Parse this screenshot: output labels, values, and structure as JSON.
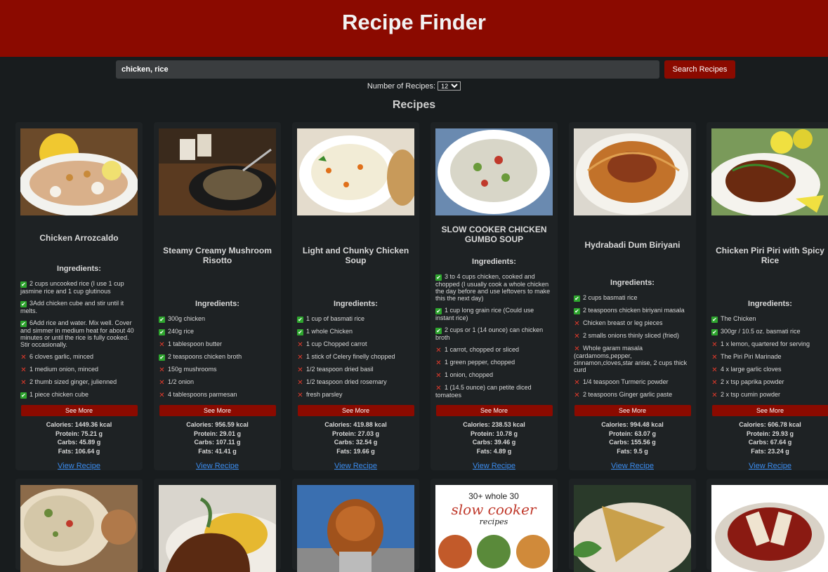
{
  "header": {
    "title": "Recipe Finder"
  },
  "search": {
    "value": "chicken, rice",
    "button_label": "Search Recipes"
  },
  "count": {
    "label": "Number of Recipes:",
    "value": "12"
  },
  "section_title": "Recipes",
  "labels": {
    "ingredients": "Ingredients:",
    "see_more": "See More",
    "view_recipe": "View Recipe"
  },
  "recipes": [
    {
      "title": "Chicken Arrozcaldo",
      "ingredients": [
        {
          "have": true,
          "text": "2 cups uncooked rice (I use 1 cup jasmine rice and 1 cup glutinous"
        },
        {
          "have": true,
          "text": "3Add chicken cube and stir until it melts."
        },
        {
          "have": true,
          "text": "6Add rice and water. Mix well. Cover and simmer in medium heat for about 40 minutes or until the rice is fully cooked. Stir occasionally."
        },
        {
          "have": false,
          "text": "6 cloves garlic, minced"
        },
        {
          "have": false,
          "text": "1 medium onion, minced"
        },
        {
          "have": false,
          "text": "2 thumb sized ginger, julienned"
        },
        {
          "have": true,
          "text": "1 piece chicken cube"
        }
      ],
      "nutrition": {
        "calories": "Calories: 1449.36 kcal",
        "protein": "Protein: 75.21 g",
        "carbs": "Carbs: 45.89 g",
        "fats": "Fats: 106.64 g"
      }
    },
    {
      "title": "Steamy Creamy Mushroom Risotto",
      "ingredients": [
        {
          "have": true,
          "text": "300g chicken"
        },
        {
          "have": true,
          "text": "240g rice"
        },
        {
          "have": false,
          "text": "1 tablespoon butter"
        },
        {
          "have": true,
          "text": "2 teaspoons chicken broth"
        },
        {
          "have": false,
          "text": "150g mushrooms"
        },
        {
          "have": false,
          "text": "1/2 onion"
        },
        {
          "have": false,
          "text": "4 tablespoons parmesan"
        }
      ],
      "nutrition": {
        "calories": "Calories: 956.59 kcal",
        "protein": "Protein: 29.01 g",
        "carbs": "Carbs: 107.11 g",
        "fats": "Fats: 41.41 g"
      }
    },
    {
      "title": "Light and Chunky Chicken Soup",
      "ingredients": [
        {
          "have": true,
          "text": "1 cup of basmati rice"
        },
        {
          "have": true,
          "text": "1 whole Chicken"
        },
        {
          "have": false,
          "text": "1 cup Chopped carrot"
        },
        {
          "have": false,
          "text": "1 stick of Celery finelly chopped"
        },
        {
          "have": false,
          "text": "1/2 teaspoon dried basil"
        },
        {
          "have": false,
          "text": "1/2 teaspoon dried rosemary"
        },
        {
          "have": false,
          "text": "fresh parsley"
        }
      ],
      "nutrition": {
        "calories": "Calories: 419.88 kcal",
        "protein": "Protein: 27.03 g",
        "carbs": "Carbs: 32.54 g",
        "fats": "Fats: 19.66 g"
      }
    },
    {
      "title": "SLOW COOKER CHICKEN GUMBO SOUP",
      "ingredients": [
        {
          "have": true,
          "text": "3 to 4 cups chicken, cooked and chopped (I usually cook a whole chicken the day before and use leftovers to make this the next day)"
        },
        {
          "have": true,
          "text": "1 cup long grain rice (Could use instant rice)"
        },
        {
          "have": true,
          "text": "2 cups or 1 (14 ounce) can chicken broth"
        },
        {
          "have": false,
          "text": "1 carrot, chopped or sliced"
        },
        {
          "have": false,
          "text": "1 green pepper, chopped"
        },
        {
          "have": false,
          "text": "1 onion, chopped"
        },
        {
          "have": false,
          "text": "1 (14.5 ounce) can petite diced tomatoes"
        }
      ],
      "nutrition": {
        "calories": "Calories: 238.53 kcal",
        "protein": "Protein: 10.78 g",
        "carbs": "Carbs: 39.46 g",
        "fats": "Fats: 4.89 g"
      }
    },
    {
      "title": "Hydrabadi Dum Biriyani",
      "ingredients": [
        {
          "have": true,
          "text": "2 cups basmati rice"
        },
        {
          "have": true,
          "text": "2 teaspoons chicken biriyani masala"
        },
        {
          "have": false,
          "text": "Chicken breast or leg pieces"
        },
        {
          "have": false,
          "text": "2 smalls onions thinly sliced (fried)"
        },
        {
          "have": false,
          "text": "Whole garam masala (cardamoms,pepper, cinnamon,cloves,star anise, 2 cups thick curd"
        },
        {
          "have": false,
          "text": "1/4 teaspoon Turmeric powder"
        },
        {
          "have": false,
          "text": "2 teaspoons Ginger garlic paste"
        }
      ],
      "nutrition": {
        "calories": "Calories: 994.48 kcal",
        "protein": "Protein: 63.07 g",
        "carbs": "Carbs: 155.56 g",
        "fats": "Fats: 9.5 g"
      }
    },
    {
      "title": "Chicken Piri Piri with Spicy Rice",
      "ingredients": [
        {
          "have": true,
          "text": "The Chicken"
        },
        {
          "have": true,
          "text": "300gr / 10.5 oz. basmati rice"
        },
        {
          "have": false,
          "text": "1 x lemon, quartered for serving"
        },
        {
          "have": false,
          "text": "The Piri Piri Marinade"
        },
        {
          "have": false,
          "text": "4 x large garlic cloves"
        },
        {
          "have": false,
          "text": "2 x tsp paprika powder"
        },
        {
          "have": false,
          "text": "2 x tsp cumin powder"
        }
      ],
      "nutrition": {
        "calories": "Calories: 606.78 kcal",
        "protein": "Protein: 29.93 g",
        "carbs": "Carbs: 67.64 g",
        "fats": "Fats: 23.24 g"
      }
    }
  ],
  "row2_banner": {
    "line1": "30+ whole 30",
    "line2": "slow cooker",
    "line3": "recipes"
  },
  "colors": {
    "header": "#8b0a00",
    "background": "#181c1e",
    "card": "#1e2224",
    "button": "#8b0a00",
    "link": "#3b8df0",
    "check": "#2ea52e",
    "cross": "#e23a2b"
  }
}
